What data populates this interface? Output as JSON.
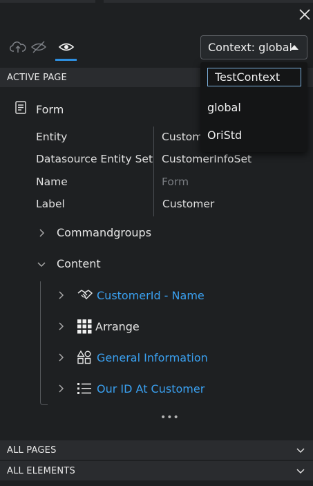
{
  "toolbar": {
    "icons": [
      "cloud-upload-icon",
      "eye-slash-icon",
      "eye-icon"
    ],
    "context_label": "Context: global"
  },
  "context_dropdown": {
    "search_value": "TestContext",
    "options": [
      "global",
      "OriStd"
    ]
  },
  "sections": {
    "active_page": "ACTIVE PAGE",
    "all_pages": "ALL PAGES",
    "all_elements": "ALL ELEMENTS"
  },
  "form": {
    "title": "Form",
    "properties": [
      {
        "key": "Entity",
        "value": "Custom"
      },
      {
        "key": "Datasource Entity Set",
        "value": "CustomerInfoSet"
      },
      {
        "key": "Name",
        "value": "Form"
      },
      {
        "key": "Label",
        "value": "Customer"
      }
    ]
  },
  "tree": {
    "commandgroups": "Commandgroups",
    "content": "Content",
    "children": [
      {
        "label": "CustomerId - Name",
        "icon": "handshake-icon",
        "link": true
      },
      {
        "label": "Arrange",
        "icon": "grid-icon",
        "link": false
      },
      {
        "label": "General Information",
        "icon": "shapes-icon",
        "link": true
      },
      {
        "label": "Our ID At Customer",
        "icon": "list-icon",
        "link": true
      }
    ],
    "more": "•••"
  },
  "colors": {
    "accent": "#2e8fe0",
    "link": "#3aa0f0",
    "background": "#1e2022",
    "header": "#2a2c2f"
  }
}
